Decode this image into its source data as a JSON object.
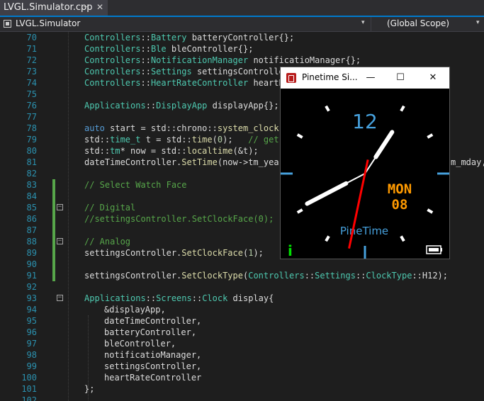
{
  "tab": {
    "title": "LVGL.Simulator.cpp",
    "pin": "⊣",
    "close": "✕"
  },
  "nav": {
    "project": "LVGL.Simulator",
    "scope": "(Global Scope)",
    "arrow": "▾"
  },
  "lines": [
    {
      "n": "70",
      "segs": [
        [
          "t",
          "Controllers"
        ],
        [
          "w",
          "::"
        ],
        [
          "t",
          "Battery"
        ],
        [
          "w",
          " batteryController{};"
        ]
      ]
    },
    {
      "n": "71",
      "segs": [
        [
          "t",
          "Controllers"
        ],
        [
          "w",
          "::"
        ],
        [
          "t",
          "Ble"
        ],
        [
          "w",
          " bleController{};"
        ]
      ]
    },
    {
      "n": "72",
      "segs": [
        [
          "t",
          "Controllers"
        ],
        [
          "w",
          "::"
        ],
        [
          "t",
          "NotificationManager"
        ],
        [
          "w",
          " notificatioManager{};"
        ]
      ]
    },
    {
      "n": "73",
      "segs": [
        [
          "t",
          "Controllers"
        ],
        [
          "w",
          "::"
        ],
        [
          "t",
          "Settings"
        ],
        [
          "w",
          " settingsControlle"
        ]
      ]
    },
    {
      "n": "74",
      "segs": [
        [
          "t",
          "Controllers"
        ],
        [
          "w",
          "::"
        ],
        [
          "t",
          "HeartRateController"
        ],
        [
          "w",
          " heartR"
        ]
      ]
    },
    {
      "n": "75",
      "segs": []
    },
    {
      "n": "76",
      "segs": [
        [
          "t",
          "Applications"
        ],
        [
          "w",
          "::"
        ],
        [
          "t",
          "DisplayApp"
        ],
        [
          "w",
          " displayApp{};"
        ]
      ]
    },
    {
      "n": "77",
      "segs": []
    },
    {
      "n": "78",
      "segs": [
        [
          "k",
          "auto"
        ],
        [
          "w",
          " start = std::chrono::"
        ],
        [
          "f",
          "system_clock"
        ],
        [
          "w",
          ":"
        ]
      ]
    },
    {
      "n": "79",
      "segs": [
        [
          "w",
          "std::"
        ],
        [
          "t",
          "time_t"
        ],
        [
          "w",
          " t = std::"
        ],
        [
          "f",
          "time"
        ],
        [
          "w",
          "("
        ],
        [
          "n",
          "0"
        ],
        [
          "w",
          ");   "
        ],
        [
          "c",
          "// get"
        ]
      ]
    },
    {
      "n": "80",
      "segs": [
        [
          "w",
          "std::"
        ],
        [
          "t",
          "tm"
        ],
        [
          "w",
          "* now = std::"
        ],
        [
          "f",
          "localtime"
        ],
        [
          "w",
          "(&t);"
        ]
      ]
    },
    {
      "n": "81",
      "segs": [
        [
          "w",
          "dateTimeController."
        ],
        [
          "f",
          "SetTime"
        ],
        [
          "w",
          "(now->tm_year"
        ]
      ],
      "tail": "m_mday,"
    },
    {
      "n": "82",
      "segs": []
    },
    {
      "n": "83",
      "segs": [
        [
          "c",
          "// Select Watch Face"
        ]
      ]
    },
    {
      "n": "84",
      "segs": []
    },
    {
      "n": "85",
      "segs": [
        [
          "c",
          "// Digital"
        ]
      ]
    },
    {
      "n": "86",
      "segs": [
        [
          "c",
          "//settingsController.SetClockFace(0);"
        ]
      ]
    },
    {
      "n": "87",
      "segs": []
    },
    {
      "n": "88",
      "segs": [
        [
          "c",
          "// Analog"
        ]
      ]
    },
    {
      "n": "89",
      "segs": [
        [
          "w",
          "settingsController."
        ],
        [
          "f",
          "SetClockFace"
        ],
        [
          "w",
          "("
        ],
        [
          "n",
          "1"
        ],
        [
          "w",
          ");"
        ]
      ]
    },
    {
      "n": "90",
      "segs": []
    },
    {
      "n": "91",
      "segs": [
        [
          "w",
          "settingsController."
        ],
        [
          "f",
          "SetClockType"
        ],
        [
          "w",
          "("
        ],
        [
          "t",
          "Controllers"
        ],
        [
          "w",
          "::"
        ],
        [
          "t",
          "Settings"
        ],
        [
          "w",
          "::"
        ],
        [
          "t",
          "ClockType"
        ],
        [
          "w",
          "::H12);"
        ]
      ]
    },
    {
      "n": "92",
      "segs": []
    },
    {
      "n": "93",
      "segs": [
        [
          "t",
          "Applications"
        ],
        [
          "w",
          "::"
        ],
        [
          "t",
          "Screens"
        ],
        [
          "w",
          "::"
        ],
        [
          "t",
          "Clock"
        ],
        [
          "w",
          " display{"
        ]
      ]
    },
    {
      "n": "94",
      "in": true,
      "segs": [
        [
          "w",
          "&displayApp,"
        ]
      ]
    },
    {
      "n": "95",
      "in": true,
      "segs": [
        [
          "w",
          "dateTimeController,"
        ]
      ]
    },
    {
      "n": "96",
      "in": true,
      "segs": [
        [
          "w",
          "batteryController,"
        ]
      ]
    },
    {
      "n": "97",
      "in": true,
      "segs": [
        [
          "w",
          "bleController,"
        ]
      ]
    },
    {
      "n": "98",
      "in": true,
      "segs": [
        [
          "w",
          "notificatioManager,"
        ]
      ]
    },
    {
      "n": "99",
      "in": true,
      "segs": [
        [
          "w",
          "settingsController,"
        ]
      ]
    },
    {
      "n": "100",
      "in": true,
      "segs": [
        [
          "w",
          "heartRateController"
        ]
      ]
    },
    {
      "n": "101",
      "segs": [
        [
          "w",
          "};"
        ]
      ]
    },
    {
      "n": "102",
      "segs": []
    }
  ],
  "simulator": {
    "title": "Pinetime Si...",
    "btn_min": "—",
    "btn_max": "☐",
    "btn_close": "✕",
    "hour_label": "12",
    "day": "MON",
    "date": "08",
    "brand": "PineTime",
    "notif_icon": "i",
    "time": {
      "hour": 8,
      "minute": 5,
      "second": 32
    },
    "colors": {
      "accent": "#46a0dc",
      "date": "#ff9a00",
      "second": "#ff0000",
      "notif": "#00e000"
    },
    "battery": "full"
  }
}
